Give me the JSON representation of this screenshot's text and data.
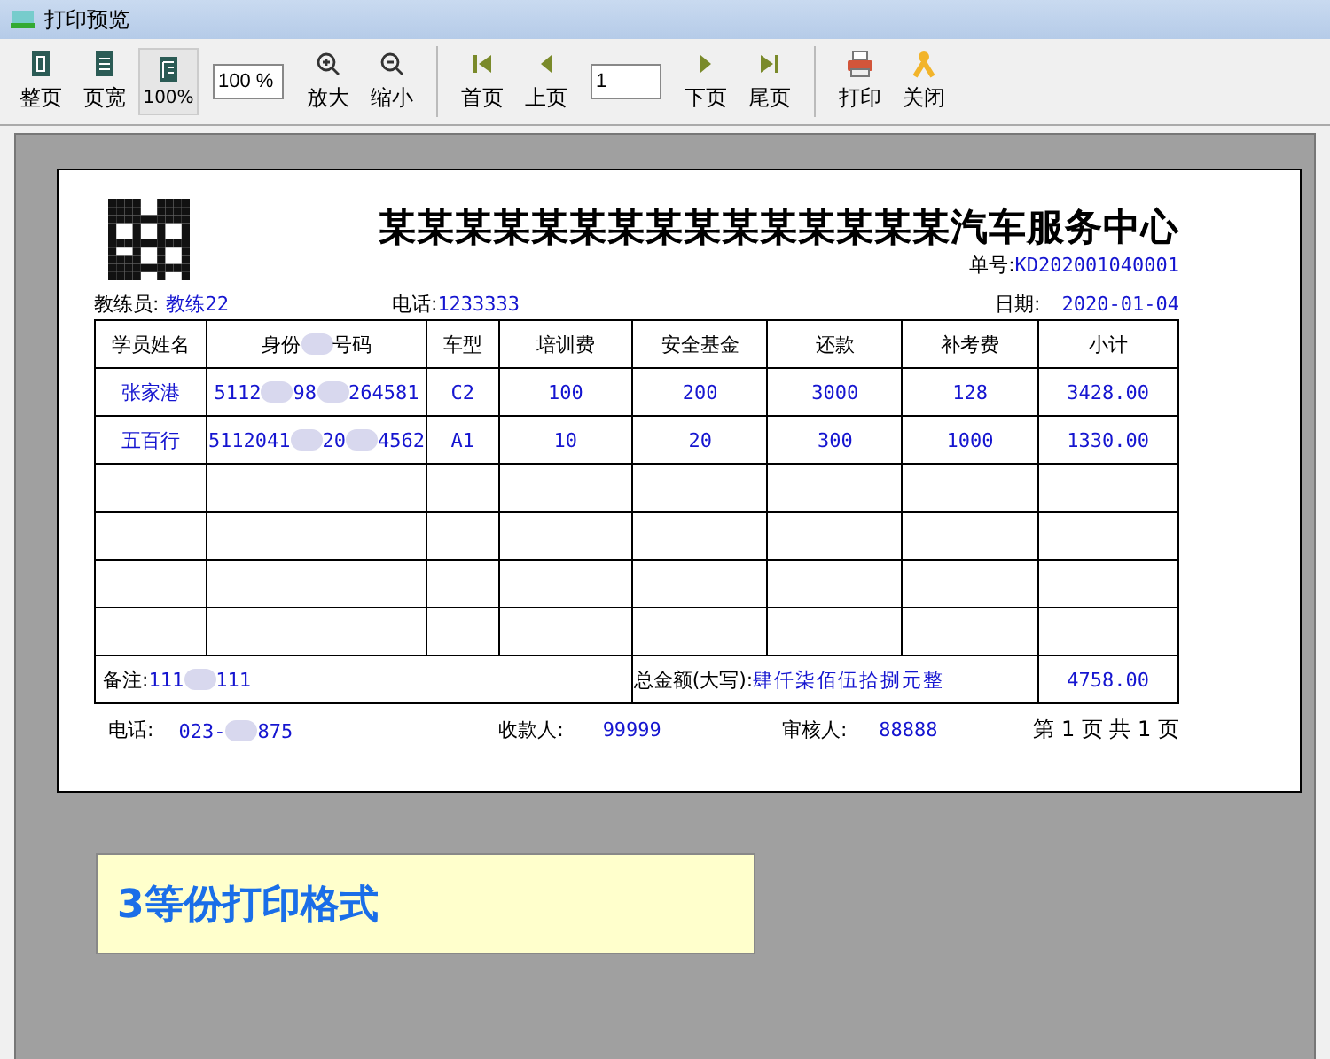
{
  "window": {
    "title": "打印预览"
  },
  "toolbar": [
    {
      "kind": "button",
      "label": "整页",
      "selected": false
    },
    {
      "kind": "button",
      "label": "页宽",
      "selected": false
    },
    {
      "kind": "button",
      "label": "100%",
      "selected": true
    },
    {
      "kind": "field",
      "value": "100 %"
    },
    {
      "kind": "button",
      "label": "放大",
      "selected": false
    },
    {
      "kind": "button",
      "label": "缩小",
      "selected": false
    },
    {
      "kind": "sep"
    },
    {
      "kind": "button",
      "label": "首页",
      "selected": false
    },
    {
      "kind": "button",
      "label": "上页",
      "selected": false
    },
    {
      "kind": "field",
      "value": "1"
    },
    {
      "kind": "button",
      "label": "下页",
      "selected": false
    },
    {
      "kind": "button",
      "label": "尾页",
      "selected": false
    },
    {
      "kind": "sep"
    },
    {
      "kind": "button",
      "label": "打印",
      "selected": false
    },
    {
      "kind": "button",
      "label": "关闭",
      "selected": false
    }
  ],
  "receipt": {
    "title": "某某某某某某某某某某某某某某某汽车服务中心",
    "number": {
      "label": "单号:",
      "value": "KD202001040001"
    },
    "coach": {
      "label": "教练员:",
      "value": "教练22"
    },
    "phone": {
      "label": "电话:",
      "value": "1233333"
    },
    "date": {
      "label": "日期:",
      "value": "2020-01-04"
    },
    "columns": [
      "学员姓名",
      "身份 号码",
      "车型",
      "培训费",
      "安全基金",
      "还款",
      "补考费",
      "小计"
    ],
    "rows": [
      [
        "张家港",
        "5112 98 264581",
        "C2",
        "100",
        "200",
        "3000",
        "128",
        "3428.00"
      ],
      [
        "五百行",
        "5112041 20 4562",
        "A1",
        "10",
        "20",
        "300",
        "1000",
        "1330.00"
      ]
    ],
    "remark": {
      "label": "备注:",
      "value": "111 111"
    },
    "total": {
      "label": "总金额(大写):",
      "words": "肆仟柒佰伍拾捌元整",
      "value": "4758.00"
    },
    "footer": {
      "phone_label": "电话:",
      "phone": "023- 875",
      "payee_label": "收款人:",
      "payee": "99999",
      "auditor_label": "审核人:",
      "auditor": "88888",
      "page": "第 1 页  共 1 页"
    }
  },
  "note": "3等份打印格式"
}
